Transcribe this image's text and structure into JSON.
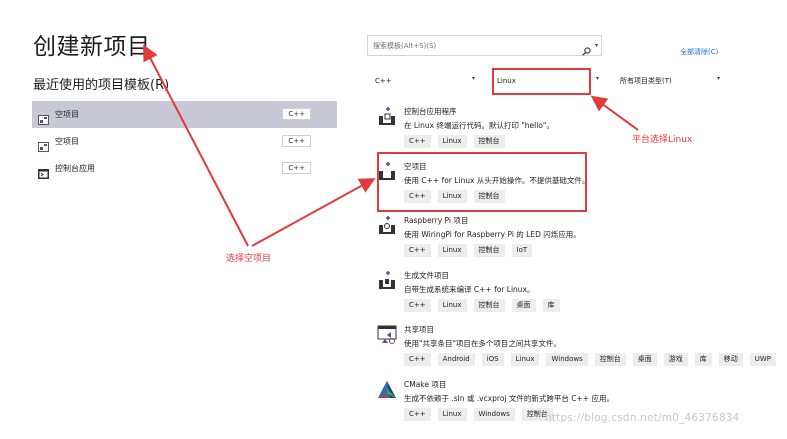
{
  "page": {
    "title": "创建新项目",
    "recent_title": "最近使用的项目模板(R)"
  },
  "recent": [
    {
      "label": "空项目",
      "lang": "C++",
      "icon": "empty-project-icon"
    },
    {
      "label": "空项目",
      "lang": "C++",
      "icon": "empty-project-icon"
    },
    {
      "label": "控制台应用",
      "lang": "C++",
      "icon": "console-app-icon"
    }
  ],
  "search": {
    "placeholder": "搜索模板(Alt+S)(S)",
    "icon": "search-icon"
  },
  "clear_all": "全部清除(C)",
  "filters": {
    "language": "C++",
    "platform": "Linux",
    "project_type": "所有项目类型(T)"
  },
  "templates": [
    {
      "name": "控制台应用程序",
      "desc": "在 Linux 终端运行代码。默认打印 \"hello\"。",
      "tags": [
        "C++",
        "Linux",
        "控制台"
      ],
      "icon": "console-app-icon"
    },
    {
      "name": "空项目",
      "desc": "使用 C++ for Linux 从头开始操作。不提供基础文件。",
      "tags": [
        "C++",
        "Linux",
        "控制台"
      ],
      "icon": "empty-project-icon"
    },
    {
      "name": "Raspberry Pi 项目",
      "desc": "使用 WiringPi for Raspberry Pi 的 LED 闪烁应用。",
      "tags": [
        "C++",
        "Linux",
        "控制台",
        "IoT"
      ],
      "icon": "raspberry-pi-icon"
    },
    {
      "name": "生成文件项目",
      "desc": "自带生成系统来编译 C++ for Linux。",
      "tags": [
        "C++",
        "Linux",
        "控制台",
        "桌面",
        "库"
      ],
      "icon": "makefile-project-icon"
    },
    {
      "name": "共享项目",
      "desc": "使用\"共享条目\"项目在多个项目之间共享文件。",
      "tags": [
        "C++",
        "Android",
        "iOS",
        "Linux",
        "Windows",
        "控制台",
        "桌面",
        "游戏",
        "库",
        "移动",
        "UWP"
      ],
      "icon": "shared-project-icon"
    },
    {
      "name": "CMake 项目",
      "desc": "生成不依赖于 .sln 或 .vcxproj 文件的新式跨平台 C++ 应用。",
      "tags": [
        "C++",
        "Linux",
        "Windows",
        "控制台"
      ],
      "icon": "cmake-icon"
    }
  ],
  "annotations": {
    "platform_note": "平台选择Linux",
    "empty_note": "选择空项目",
    "color": "#e33b3b"
  },
  "watermark": "https://blog.csdn.net/m0_46376834"
}
